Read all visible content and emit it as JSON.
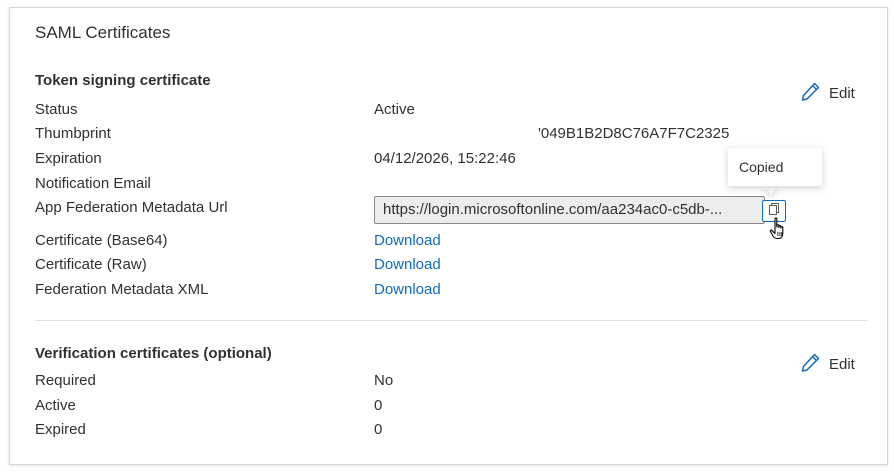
{
  "title": "SAML Certificates",
  "token_signing": {
    "section_title": "Token signing certificate",
    "edit_label": "Edit",
    "status_label": "Status",
    "status_value": "Active",
    "thumbprint_label": "Thumbprint",
    "thumbprint_value": "'049B1B2D8C76A7F7C2325",
    "expiration_label": "Expiration",
    "expiration_value": "04/12/2026, 15:22:46",
    "notification_email_label": "Notification Email",
    "app_federation_label": "App Federation Metadata Url",
    "app_federation_url": "https://login.microsoftonline.com/aa234ac0-c5db-...",
    "copied_tooltip": "Copied",
    "cert_base64_label": "Certificate (Base64)",
    "cert_raw_label": "Certificate (Raw)",
    "federation_xml_label": "Federation Metadata XML",
    "download_label": "Download"
  },
  "verification": {
    "section_title": "Verification certificates (optional)",
    "edit_label": "Edit",
    "required_label": "Required",
    "required_value": "No",
    "active_label": "Active",
    "active_value": "0",
    "expired_label": "Expired",
    "expired_value": "0"
  },
  "icons": {
    "edit": "pencil-icon",
    "copy": "copy-icon",
    "cursor": "hand-pointer-icon"
  },
  "colors": {
    "link": "#0f6cbd",
    "edit_icon": "#0f6cbd",
    "text": "#323130",
    "copy_border": "#0f6cbd"
  }
}
